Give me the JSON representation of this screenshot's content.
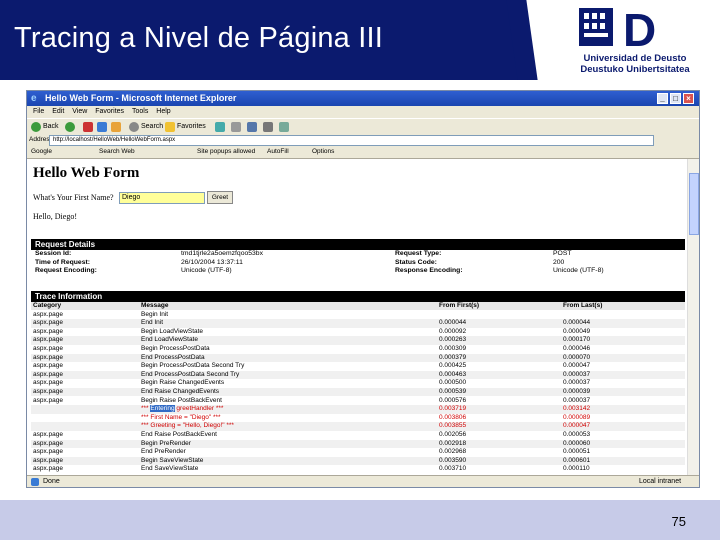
{
  "slide": {
    "title": "Tracing a Nivel de Página III",
    "page_number": "75",
    "logo_line1": "Universidad de Deusto",
    "logo_line2": "Deustuko Unibertsitatea",
    "logo_letter": "D",
    "colors": {
      "header": "#0b1a6e",
      "footer": "#c7cbe8"
    }
  },
  "browser": {
    "window_title": "Hello Web Form - Microsoft Internet Explorer",
    "menu": [
      "File",
      "Edit",
      "View",
      "Favorites",
      "Tools",
      "Help"
    ],
    "toolbar": {
      "back": "Back",
      "search": "Search",
      "favorites": "Favorites"
    },
    "address_label": "Address",
    "address_value": "http://localhost/HelloWeb/HelloWebForm.aspx",
    "links_label": "Google",
    "links_search": "Search Web",
    "links_items": [
      "Site popups allowed",
      "AutoFill",
      "Options"
    ],
    "status_left": "Done",
    "status_right": "Local intranet"
  },
  "page": {
    "heading": "Hello Web Form",
    "prompt": "What's Your First Name?",
    "name_value": "Diego",
    "greet_button": "Greet",
    "hello_text": "Hello, Diego!",
    "request_details": {
      "header": "Request Details",
      "left": [
        {
          "label": "Session Id:",
          "value": "tmd1tjrle2a5oemzfqoo53bx"
        },
        {
          "label": "Time of Request:",
          "value": "26/10/2004 13:37:11"
        },
        {
          "label": "Request Encoding:",
          "value": "Unicode (UTF-8)"
        }
      ],
      "right": [
        {
          "label": "Request Type:",
          "value": "POST"
        },
        {
          "label": "Status Code:",
          "value": "200"
        },
        {
          "label": "Response Encoding:",
          "value": "Unicode (UTF-8)"
        }
      ]
    },
    "trace": {
      "header": "Trace Information",
      "columns": [
        "Category",
        "Message",
        "From First(s)",
        "From Last(s)"
      ],
      "rows": [
        [
          "aspx.page",
          "Begin Init",
          "",
          ""
        ],
        [
          "aspx.page",
          "End Init",
          "0.000044",
          "0.000044"
        ],
        [
          "aspx.page",
          "Begin LoadViewState",
          "0.000092",
          "0.000049"
        ],
        [
          "aspx.page",
          "End LoadViewState",
          "0.000263",
          "0.000170"
        ],
        [
          "aspx.page",
          "Begin ProcessPostData",
          "0.000309",
          "0.000046"
        ],
        [
          "aspx.page",
          "End ProcessPostData",
          "0.000379",
          "0.000070"
        ],
        [
          "aspx.page",
          "Begin ProcessPostData Second Try",
          "0.000425",
          "0.000047"
        ],
        [
          "aspx.page",
          "End ProcessPostData Second Try",
          "0.000463",
          "0.000037"
        ],
        [
          "aspx.page",
          "Begin Raise ChangedEvents",
          "0.000500",
          "0.000037"
        ],
        [
          "aspx.page",
          "End Raise ChangedEvents",
          "0.000539",
          "0.000039"
        ],
        [
          "aspx.page",
          "Begin Raise PostBackEvent",
          "0.000576",
          "0.000037"
        ],
        [
          "",
          "*** Entering greetHandler ***",
          "0.003719",
          "0.003142"
        ],
        [
          "",
          "*** First Name = \"Diego\" ***",
          "0.003806",
          "0.000089"
        ],
        [
          "",
          "*** Greeting = \"Hello, Diego!\" ***",
          "0.003855",
          "0.000047"
        ],
        [
          "aspx.page",
          "End Raise PostBackEvent",
          "0.002056",
          "0.000053"
        ],
        [
          "aspx.page",
          "Begin PreRender",
          "0.002918",
          "0.000060"
        ],
        [
          "aspx.page",
          "End PreRender",
          "0.002968",
          "0.000051"
        ],
        [
          "aspx.page",
          "Begin SaveViewState",
          "0.003590",
          "0.000601"
        ],
        [
          "aspx.page",
          "End SaveViewState",
          "0.003710",
          "0.000110"
        ]
      ],
      "warn_rows": [
        11,
        12,
        13
      ],
      "highlight_word": "Entering"
    }
  }
}
